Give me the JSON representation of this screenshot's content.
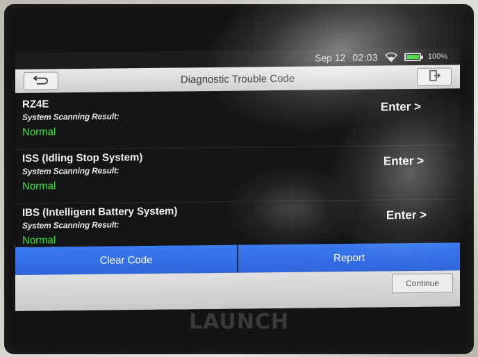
{
  "status_bar": {
    "date": "Sep 12",
    "time": "02:03",
    "battery": "100%",
    "battery_color": "#3bd93b"
  },
  "header": {
    "title": "Diagnostic Trouble Code",
    "back_icon": "back-arrow-icon",
    "exit_icon": "exit-icon"
  },
  "systems": [
    {
      "name": "RZ4E",
      "subtitle": "System Scanning Result:",
      "status": "Normal",
      "action": "Enter >"
    },
    {
      "name": "ISS (Idling Stop System)",
      "subtitle": "System Scanning Result:",
      "status": "Normal",
      "action": "Enter >"
    },
    {
      "name": "IBS (Intelligent Battery System)",
      "subtitle": "System Scanning Result:",
      "status": "Normal",
      "action": "Enter >"
    }
  ],
  "actions": {
    "clear_code": "Clear Code",
    "report": "Report",
    "continue": "Continue"
  },
  "device": {
    "brand": "LAUNCH"
  },
  "colors": {
    "accent": "#2f66dc",
    "status_ok": "#3ee23e"
  }
}
